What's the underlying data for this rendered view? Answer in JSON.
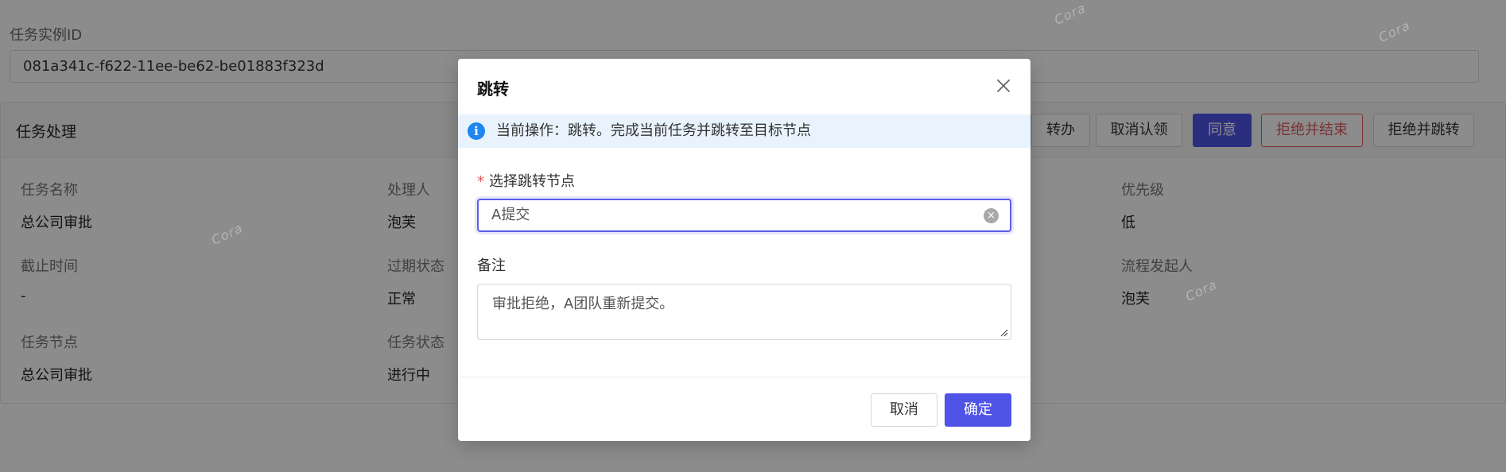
{
  "background": {
    "instance_id_label": "任务实例ID",
    "instance_id_value": "081a341c-f622-11ee-be62-be01883f323d",
    "section_title": "任务处理",
    "actions": {
      "transfer": "转办",
      "cancel_claim": "取消认领",
      "approve": "同意",
      "reject_end": "拒绝并结束",
      "reject_jump": "拒绝并跳转"
    },
    "info": {
      "task_name_label": "任务名称",
      "task_name_value": "总公司审批",
      "assignee_label": "处理人",
      "assignee_value": "泡芙",
      "priority_label": "优先级",
      "priority_value": "低",
      "deadline_label": "截止时间",
      "deadline_value": "-",
      "expire_status_label": "过期状态",
      "expire_status_value": "正常",
      "initiator_label": "流程发起人",
      "initiator_value": "泡芙",
      "task_node_label": "任务节点",
      "task_node_value": "总公司审批",
      "task_status_label": "任务状态",
      "task_status_value": "进行中"
    },
    "watermark_text": "Cora"
  },
  "dialog": {
    "title": "跳转",
    "alert_text": "当前操作：跳转。完成当前任务并跳转至目标节点",
    "target_node_label": "选择跳转节点",
    "target_node_value": "A提交",
    "remark_label": "备注",
    "remark_value": "审批拒绝，A团队重新提交。",
    "cancel_label": "取消",
    "confirm_label": "确定"
  },
  "colors": {
    "primary": "#4f53e6",
    "danger": "#e05b5b",
    "info": "#1f86f0",
    "alert_bg": "#e8f3fe"
  }
}
